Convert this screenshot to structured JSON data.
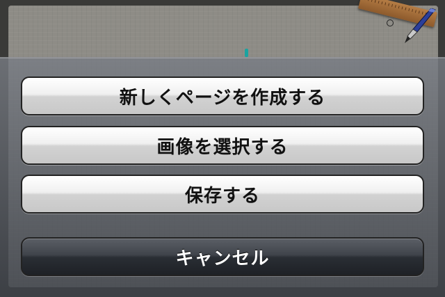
{
  "action_sheet": {
    "buttons": [
      {
        "label": "新しくページを作成する"
      },
      {
        "label": "画像を選択する"
      },
      {
        "label": "保存する"
      }
    ],
    "cancel_label": "キャンセル"
  },
  "colors": {
    "cursor_accent": "#1aa3a0",
    "ruler_wood": "#a06a36",
    "pen_blue": "#2c3f9a"
  },
  "icons": {
    "ruler": "ruler-icon",
    "pen": "pen-icon"
  }
}
